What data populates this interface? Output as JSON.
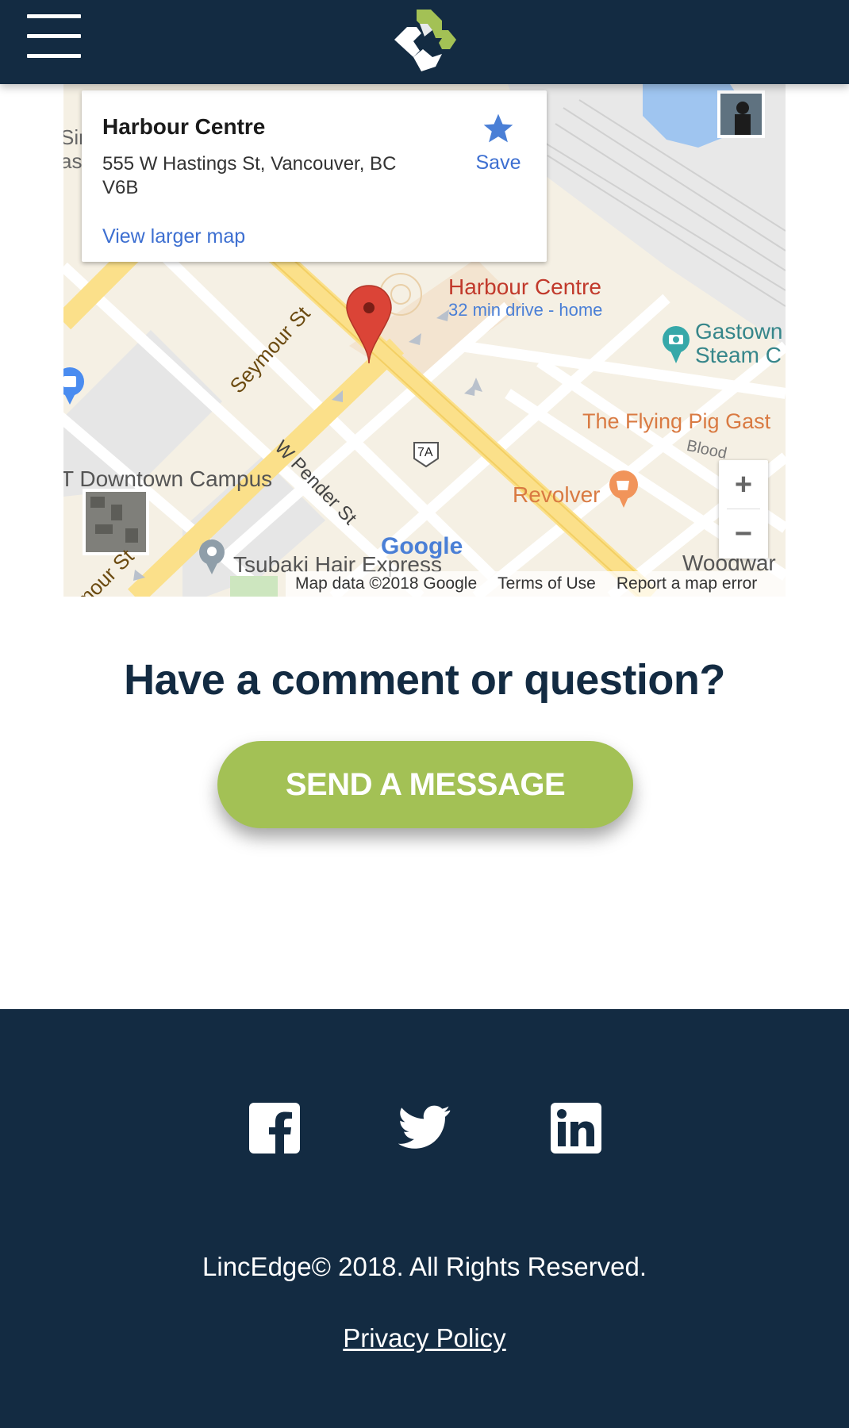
{
  "header": {
    "menu_icon": "hamburger-menu-icon",
    "logo": "linc-edge-logo"
  },
  "map": {
    "info_card": {
      "title": "Harbour Centre",
      "address": "555 W Hastings St, Vancouver, BC V6B",
      "save_label": "Save",
      "view_larger_label": "View larger map"
    },
    "labels": {
      "marker_title": "Harbour Centre",
      "marker_subtitle": "32 min drive - home",
      "gastown_1": "Gastown",
      "gastown_2": "Steam C",
      "flying_pig": "The Flying Pig Gast",
      "blood": "Blood",
      "revolver": "Revolver",
      "seymour": "Seymour St",
      "pender": "W Pender St",
      "downtown": "T Downtown Campus",
      "tsubaki": "Tsubaki Hair Express",
      "woodward": "Woodwar",
      "route": "7A",
      "seymour_lower": "mour St",
      "sir": "Sir",
      "as": "as",
      "google": "Google"
    },
    "zoom_in": "+",
    "zoom_out": "−",
    "attribution": {
      "map_data": "Map data ©2018 Google",
      "terms": "Terms of Use",
      "report": "Report a map error"
    },
    "colors": {
      "marker": "#db4437",
      "link": "#3d6fd1",
      "road_major": "#fbe08a",
      "water": "#9fc5f0"
    }
  },
  "cta": {
    "heading": "Have a comment or question?",
    "button_label": "SEND A MESSAGE"
  },
  "footer": {
    "social": [
      "facebook-icon",
      "twitter-icon",
      "linkedin-icon"
    ],
    "copyright": "LincEdge© 2018. All Rights Reserved.",
    "privacy_label": "Privacy Policy"
  },
  "theme": {
    "navy": "#132b42",
    "accent_green": "#a3c155"
  }
}
